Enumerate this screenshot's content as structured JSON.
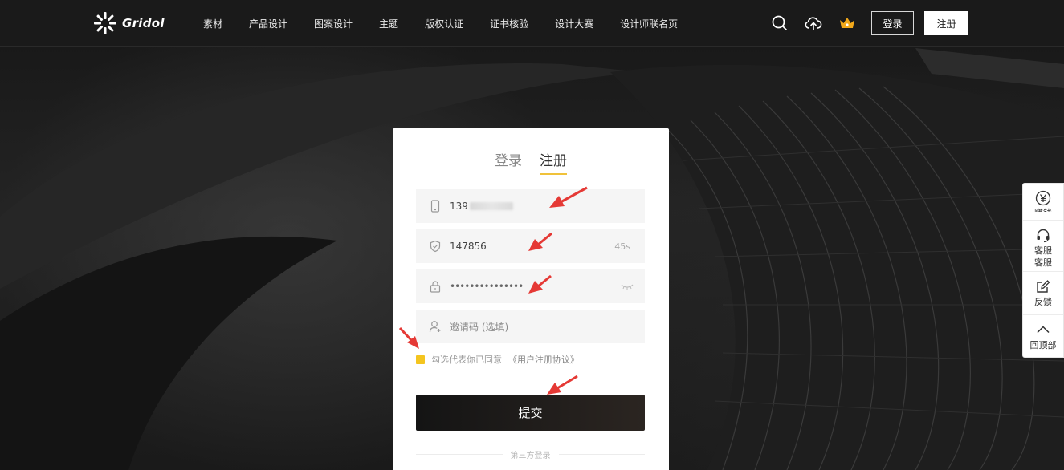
{
  "header": {
    "logo_text": "Gridol",
    "nav": [
      "素材",
      "产品设计",
      "图案设计",
      "主题",
      "版权认证",
      "证书核验",
      "设计大赛",
      "设计师联名页"
    ],
    "icons": [
      "search-icon",
      "cloud-upload-icon",
      "crown-icon"
    ],
    "login_label": "登录",
    "register_label": "注册"
  },
  "card": {
    "tab_login": "登录",
    "tab_register": "注册",
    "phone_value": "139",
    "code_value": "147856",
    "countdown": "45s",
    "password_value": "•••••••••••••••",
    "invite_placeholder": "邀请码 (选填)",
    "agree_text": "勾选代表你已同意",
    "agree_link": "《用户注册协议》",
    "submit_label": "提交",
    "third_party_label": "第三方登录"
  },
  "sidebar": {
    "items": [
      {
        "icon": "yen-icon",
        "label": "赚钱"
      },
      {
        "icon": "headset-icon",
        "label": "客服"
      },
      {
        "icon": "edit-icon",
        "label": "反馈"
      },
      {
        "icon": "chevron-up-icon",
        "label": "回顶部"
      }
    ],
    "service_sub": "客服"
  },
  "colors": {
    "accent": "#f0c23a",
    "checkbox": "#f4c51f",
    "annotation": "#e53935"
  }
}
